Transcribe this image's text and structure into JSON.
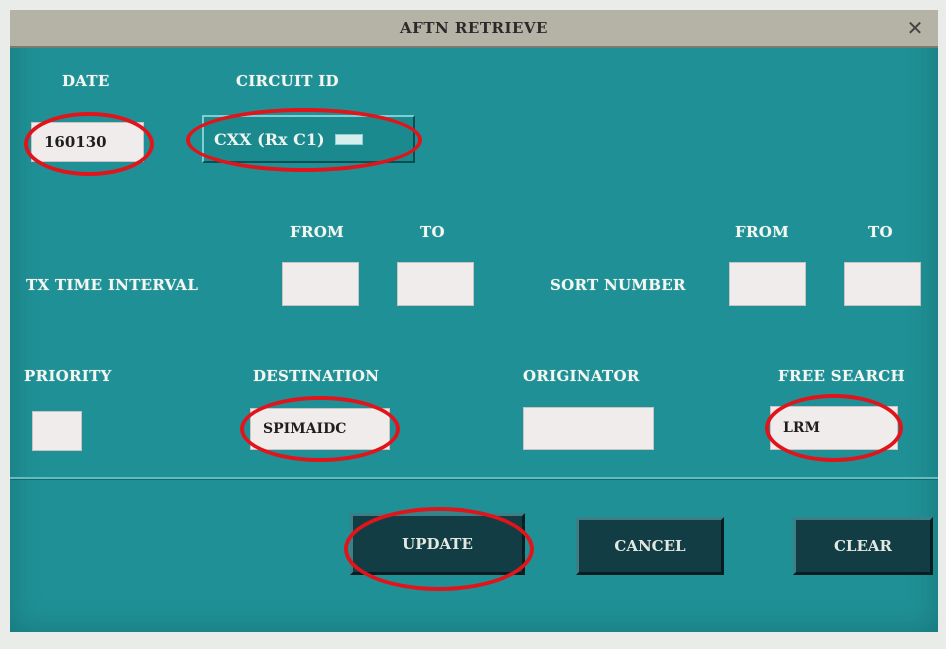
{
  "dialog": {
    "title": "AFTN RETRIEVE",
    "close_symbol": "✕"
  },
  "date": {
    "label": "DATE",
    "value": "160130"
  },
  "circuit": {
    "label": "CIRCUIT ID",
    "value": "CXX (Rx C1)"
  },
  "tx_time_interval": {
    "label": "TX TIME INTERVAL",
    "from_label": "FROM",
    "to_label": "TO",
    "from_value": "",
    "to_value": ""
  },
  "sort_number": {
    "label": "SORT NUMBER",
    "from_label": "FROM",
    "to_label": "TO",
    "from_value": "",
    "to_value": ""
  },
  "priority": {
    "label": "PRIORITY",
    "value": ""
  },
  "destination": {
    "label": "DESTINATION",
    "value": "SPIMAIDC"
  },
  "originator": {
    "label": "ORIGINATOR",
    "value": ""
  },
  "free_search": {
    "label": "FREE SEARCH",
    "value": "LRM"
  },
  "buttons": {
    "update": "UPDATE",
    "cancel": "CANCEL",
    "clear": "CLEAR"
  },
  "colors": {
    "dialog_background": "#1f9196",
    "title_bar": "#b5b2a6",
    "field_background": "#f1ecec",
    "button_background": "#123d44",
    "highlight_circle": "#e0151b"
  }
}
